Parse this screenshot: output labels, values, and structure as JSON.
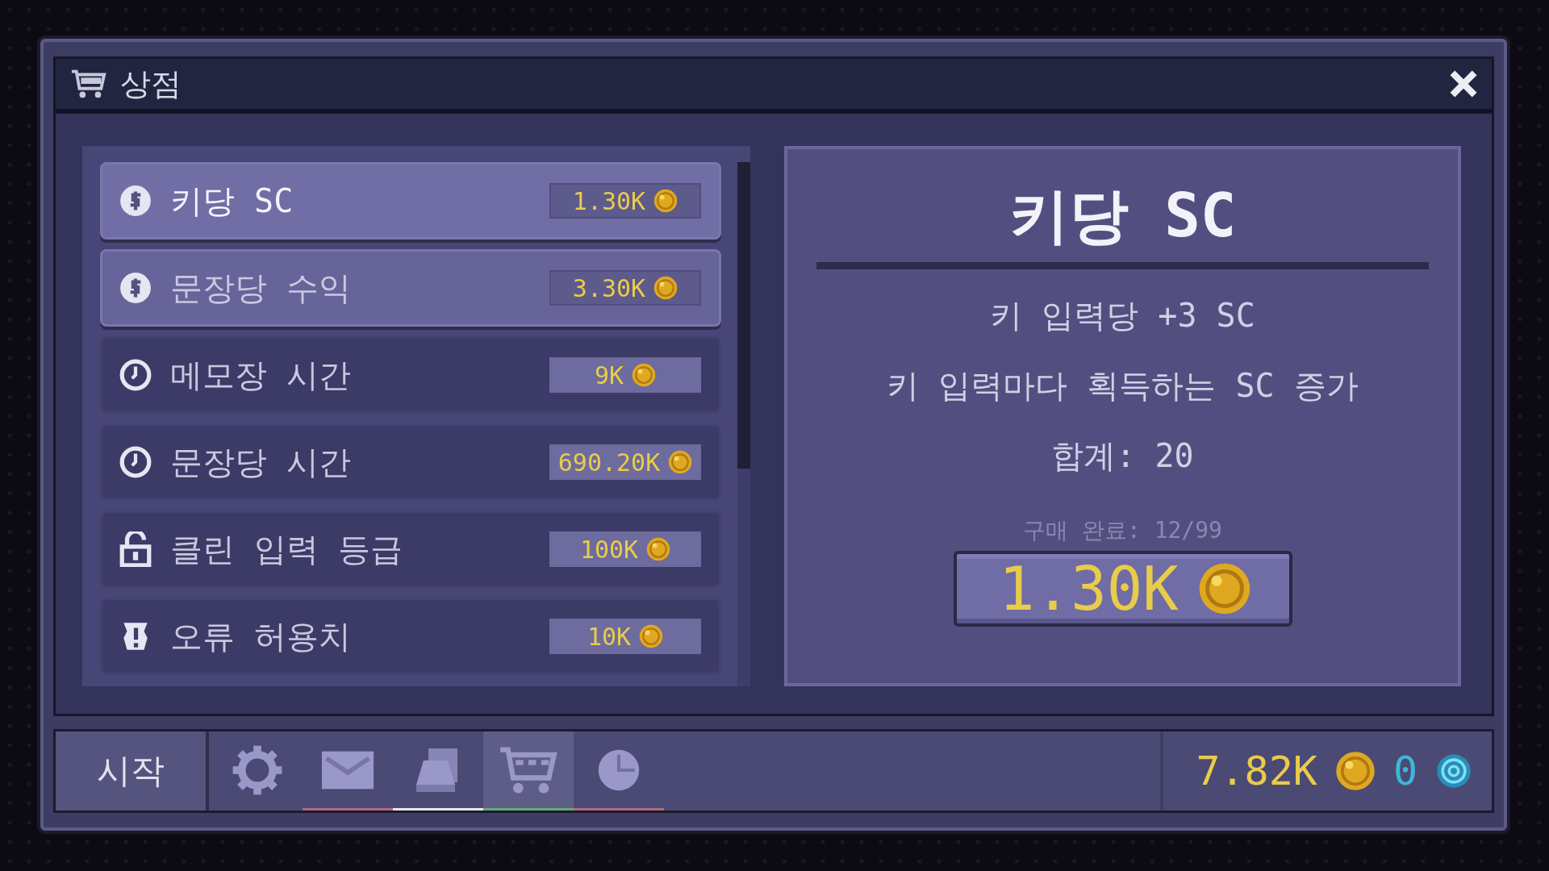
{
  "window": {
    "title": "상점"
  },
  "items": [
    {
      "kind": "coin",
      "label": "키당 SC",
      "price": "1.30K",
      "selected": true,
      "affordable": true
    },
    {
      "kind": "coin",
      "label": "문장당 수익",
      "price": "3.30K",
      "selected": false,
      "affordable": true
    },
    {
      "kind": "clock",
      "label": "메모장 시간",
      "price": "9K",
      "selected": false,
      "affordable": false
    },
    {
      "kind": "clock",
      "label": "문장당 시간",
      "price": "690.20K",
      "selected": false,
      "affordable": false
    },
    {
      "kind": "lock",
      "label": "클린 입력 등급",
      "price": "100K",
      "selected": false,
      "affordable": false
    },
    {
      "kind": "warning",
      "label": "오류 허용치",
      "price": "10K",
      "selected": false,
      "affordable": false
    }
  ],
  "detail": {
    "title": "키당 SC",
    "effect": "키 입력당 +3 SC",
    "description": "키 입력마다 획득하는 SC 증가",
    "total": "합계: 20",
    "purchased": "구매 완료: 12/99",
    "buy_price": "1.30K"
  },
  "taskbar": {
    "start": "시작",
    "apps": [
      {
        "kind": "gear",
        "selected": false
      },
      {
        "kind": "mail",
        "selected": false,
        "color": "#b06a86"
      },
      {
        "kind": "bell",
        "selected": false,
        "color": "#e8e8f0"
      },
      {
        "kind": "cart",
        "selected": true,
        "color": "#6aa87a"
      },
      {
        "kind": "pie",
        "selected": false,
        "color": "#b06a86"
      }
    ],
    "balance": "7.82K",
    "gems": "0"
  }
}
